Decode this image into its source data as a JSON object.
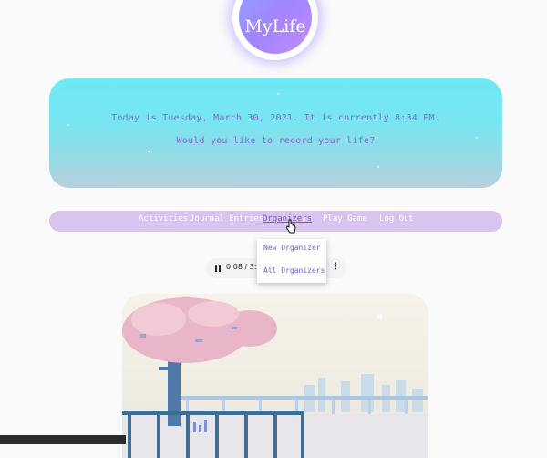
{
  "logo": {
    "text": "MyLife"
  },
  "hero": {
    "line1": "Today is Tuesday, March 30, 2021. It is currently 8:34 PM.",
    "line2": "Would you like to record your life?"
  },
  "nav": {
    "items": [
      {
        "label": "Activities"
      },
      {
        "label": "Journal Entries"
      },
      {
        "label": "Organizers"
      },
      {
        "label": "Play Game"
      },
      {
        "label": "Log Out"
      }
    ],
    "active": "Organizers"
  },
  "player": {
    "time": "0:08 / 3:04"
  },
  "dropdown": {
    "items": [
      {
        "label": "New Organizer"
      },
      {
        "label": "All Organizers"
      }
    ]
  },
  "colors": {
    "accent": "#8a63d8",
    "nav_bg": "#d9c4ef",
    "hero_top": "#6ee9f5",
    "hero_bottom": "#b8cfe0"
  }
}
